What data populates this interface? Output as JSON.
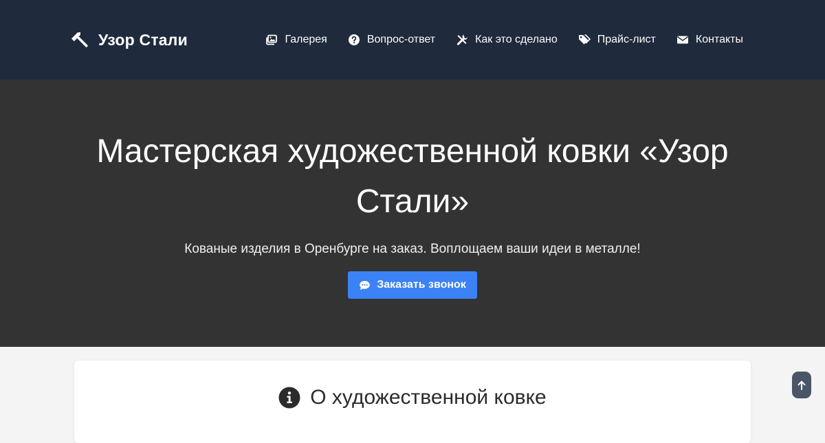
{
  "header": {
    "brand": {
      "name": "Узор Стали",
      "icon": "hammer-icon"
    },
    "nav": [
      {
        "label": "Галерея",
        "icon": "gallery-icon"
      },
      {
        "label": "Вопрос-ответ",
        "icon": "question-circle-icon"
      },
      {
        "label": "Как это сделано",
        "icon": "tools-icon"
      },
      {
        "label": "Прайс-лист",
        "icon": "tags-icon"
      },
      {
        "label": "Контакты",
        "icon": "envelope-icon"
      }
    ]
  },
  "hero": {
    "title": "Мастерская художественной ковки «Узор Стали»",
    "subtitle": "Кованые изделия в Оренбурге на заказ. Воплощаем ваши идеи в металле!",
    "cta_label": "Заказать звонок",
    "cta_icon": "comment-dots-icon"
  },
  "about": {
    "title": "О художественной ковке",
    "icon": "info-circle-icon"
  },
  "back_to_top": {
    "icon": "arrow-up-icon"
  },
  "colors": {
    "header_bg": "#1f2a3c",
    "hero_bg": "#333333",
    "page_bg": "#f4f4f4",
    "accent": "#3b82f6",
    "back_to_top_bg": "#4a5568"
  }
}
